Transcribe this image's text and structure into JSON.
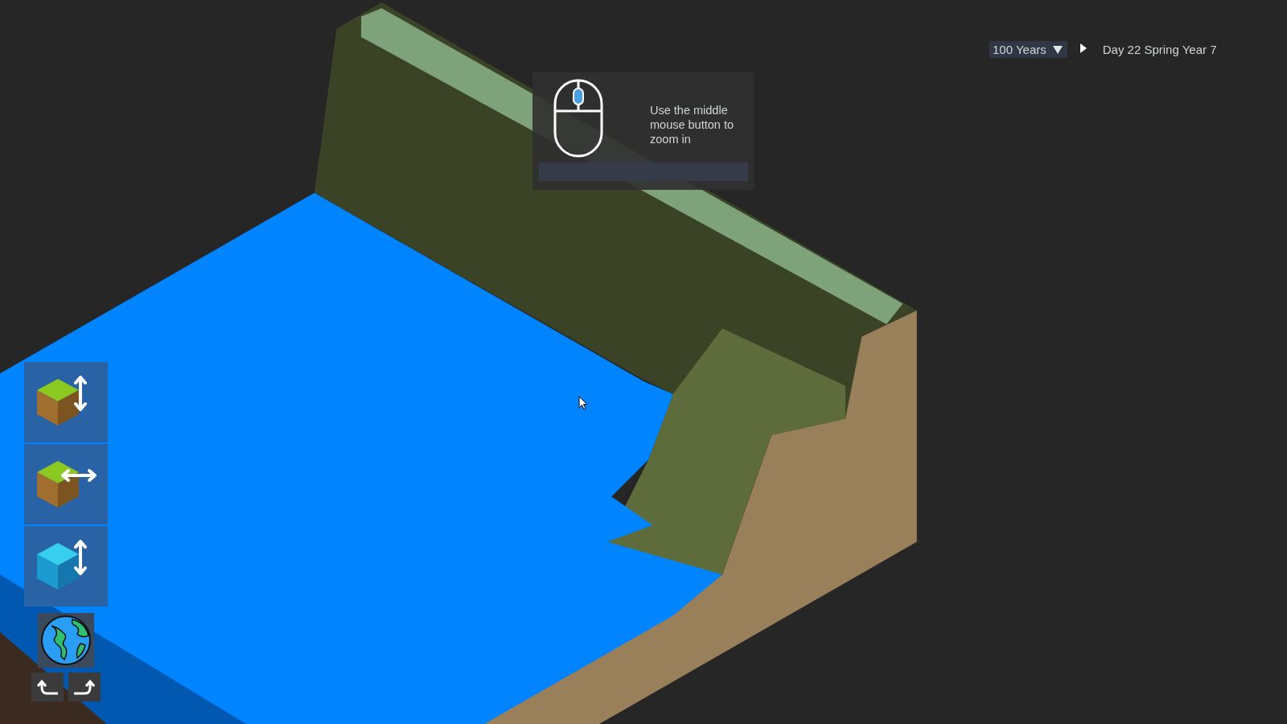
{
  "time_controls": {
    "speed": "100 Years",
    "date": "Day 22 Spring Year 7"
  },
  "hint": {
    "text": "Use the middle mouse button to zoom in"
  },
  "tools": [
    {
      "kind": "raise-terrain",
      "selected": false
    },
    {
      "kind": "move-terrain",
      "selected": false
    },
    {
      "kind": "raise-water",
      "selected": false
    }
  ]
}
